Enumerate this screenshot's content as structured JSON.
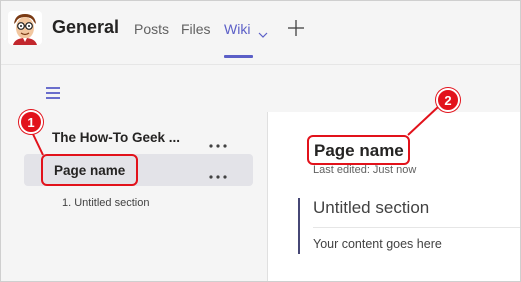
{
  "header": {
    "channel_title": "General",
    "tabs": [
      {
        "label": "Posts",
        "active": false
      },
      {
        "label": "Files",
        "active": false
      },
      {
        "label": "Wiki",
        "active": true
      }
    ],
    "icons": {
      "avatar": "geek-avatar-icon",
      "tab_menu": "chevron-down-icon",
      "add_tab": "plus-icon"
    }
  },
  "toolbar": {
    "icon": "hamburger-menu-icon"
  },
  "sidebar": {
    "items": [
      {
        "label": "The How-To Geek ...",
        "more_icon": "more-options-icon"
      },
      {
        "label": "Page name",
        "more_icon": "more-options-icon",
        "selected": true
      }
    ],
    "sections": [
      {
        "label": "1. Untitled section"
      }
    ]
  },
  "main": {
    "page_title": "Page name",
    "last_edited": "Last edited: Just now",
    "section_heading": "Untitled section",
    "section_body": "Your content goes here"
  },
  "callouts": [
    {
      "number": "1"
    },
    {
      "number": "2"
    }
  ],
  "colors": {
    "accent": "#5b5fc7",
    "callout_red": "#e2121b",
    "background_gray": "#f5f5f5",
    "selected_row": "#e3e3e8",
    "section_bar": "#464775"
  }
}
